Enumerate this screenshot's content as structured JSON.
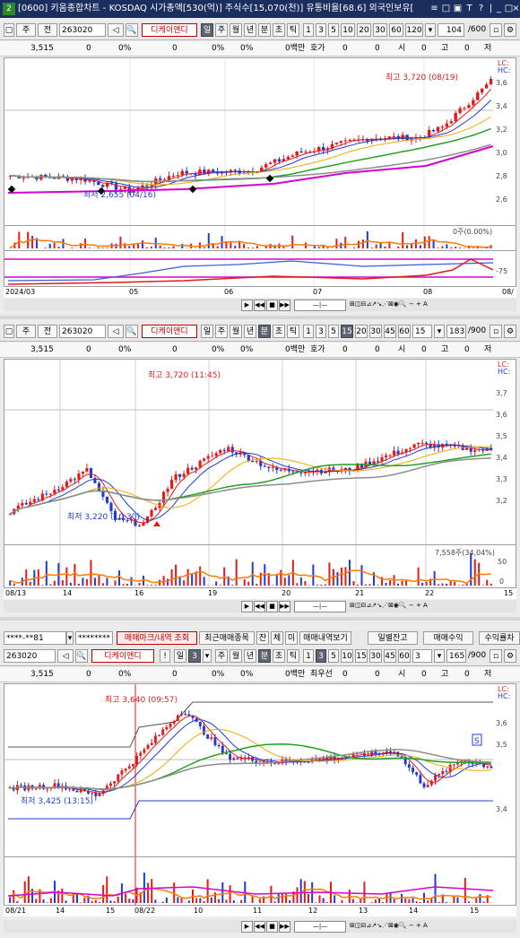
{
  "window": {
    "title": "[0600] 키움종합차트 - KOSDAQ 시가총액[530(억)] 주식수[15,070(천)] 유통비율[68.6] 외국인보유[",
    "app_icon": "2",
    "controls": [
      "≡",
      "□",
      "▣",
      "T",
      "?",
      "|",
      "_",
      "□",
      "×"
    ]
  },
  "panel1": {
    "toolbar": {
      "mode1": "주",
      "mode2": "전",
      "code": "263020",
      "name": "디케이앤디",
      "periods": [
        "일",
        "주",
        "월",
        "년",
        "분",
        "초",
        "틱"
      ],
      "minutes": [
        "1",
        "3",
        "5",
        "10",
        "20",
        "30",
        "60",
        "120"
      ],
      "count": "104",
      "total": "600"
    },
    "quotes": {
      "price": "3,515",
      "v1": "0",
      "p1": "0%",
      "v2": "0",
      "p2": "0%",
      "p3": "0%",
      "unit": "0백만",
      "label": "호가",
      "a": "0",
      "b": "0",
      "c": "시",
      "d": "0",
      "e": "고",
      "f": "0",
      "g": "저"
    },
    "annot_high": "최고 3,720 (08/19)",
    "annot_low": "최저 2,655 (04/16)",
    "yticks": [
      "3,6",
      "3,4",
      "3,2",
      "3,0",
      "2,8",
      "2,6"
    ],
    "top_labels": [
      "LC:",
      "HC:"
    ],
    "vol_label": "0주(0.00%)",
    "ind_label": "-75",
    "xlabels": [
      "2024/03",
      "05",
      "06",
      "07",
      "08",
      "08/"
    ]
  },
  "panel2": {
    "toolbar": {
      "mode1": "주",
      "mode2": "전",
      "code": "263020",
      "name": "디케이앤디",
      "periods": [
        "일",
        "주",
        "월",
        "년",
        "분",
        "초",
        "틱"
      ],
      "minutes": [
        "1",
        "3",
        "5",
        "15",
        "20",
        "30",
        "45",
        "60"
      ],
      "min_sel": "15",
      "count": "183",
      "total": "900"
    },
    "quotes": {
      "price": "3,515",
      "v1": "0",
      "p1": "0%",
      "v2": "0",
      "p2": "0%",
      "p3": "0%",
      "unit": "0백만",
      "label": "호가",
      "a": "0",
      "b": "0",
      "c": "시",
      "d": "0",
      "e": "고",
      "f": "0",
      "g": "저"
    },
    "annot_high": "최고 3,720 (11:45)",
    "annot_low": "최저 3,220 (10:30)",
    "yticks": [
      "3,7",
      "3,6",
      "3,5",
      "3,4",
      "3,3",
      "3,2"
    ],
    "top_labels": [
      "LC:",
      "HC:"
    ],
    "vol_label": "7,558주(34,04%)",
    "vol_ticks": [
      "50",
      "0"
    ],
    "xlabels": [
      "08/13",
      "14",
      "16",
      "19",
      "20",
      "21",
      "22",
      "15"
    ]
  },
  "panel3": {
    "top": {
      "acct": "****-**81",
      "pwd": "********",
      "btn1": "매매마크/내역 조회",
      "btn2": "최근매매종목",
      "btn3": "잔",
      "btn4": "체",
      "btn5": "미",
      "btn6": "매매내역보기",
      "btn7": "일별잔고",
      "btn8": "매매수익",
      "btn9": "수익률차"
    },
    "toolbar": {
      "code": "263020",
      "name": "디케이앤디",
      "flag": "!",
      "day": "일",
      "num": "3",
      "periods": [
        "주",
        "월",
        "년",
        "분",
        "초",
        "틱"
      ],
      "minutes": [
        "1",
        "3",
        "5",
        "10",
        "15",
        "30",
        "45",
        "60"
      ],
      "min_sel": "3",
      "count": "165",
      "total": "900"
    },
    "quotes": {
      "price": "3,515",
      "v1": "0",
      "p1": "0%",
      "v2": "0",
      "p2": "0%",
      "p3": "0%",
      "unit": "0백만",
      "label": "최우선",
      "a": "0",
      "b": "0",
      "c": "시",
      "d": "0",
      "e": "고",
      "f": "0",
      "g": "저"
    },
    "annot_high": "최고 3,640 (09:57)",
    "annot_low": "최저 3,425 (13:15)",
    "marker": "S",
    "yticks": [
      "3,6",
      "3,5",
      "3,4"
    ],
    "top_labels": [
      "LC:",
      "HC:"
    ],
    "xlabels": [
      "08/21",
      "14",
      "15",
      "08/22",
      "10",
      "11",
      "12",
      "13",
      "14",
      "15"
    ]
  },
  "colors": {
    "up": "#e41a1a",
    "down": "#1f3bd6",
    "ma5": "#e41a1a",
    "ma10": "#1f3bd6",
    "ma20": "#f2a800",
    "ma60": "#23a023",
    "ma120": "#8c8c8c",
    "ma_m": "#d400d4"
  }
}
